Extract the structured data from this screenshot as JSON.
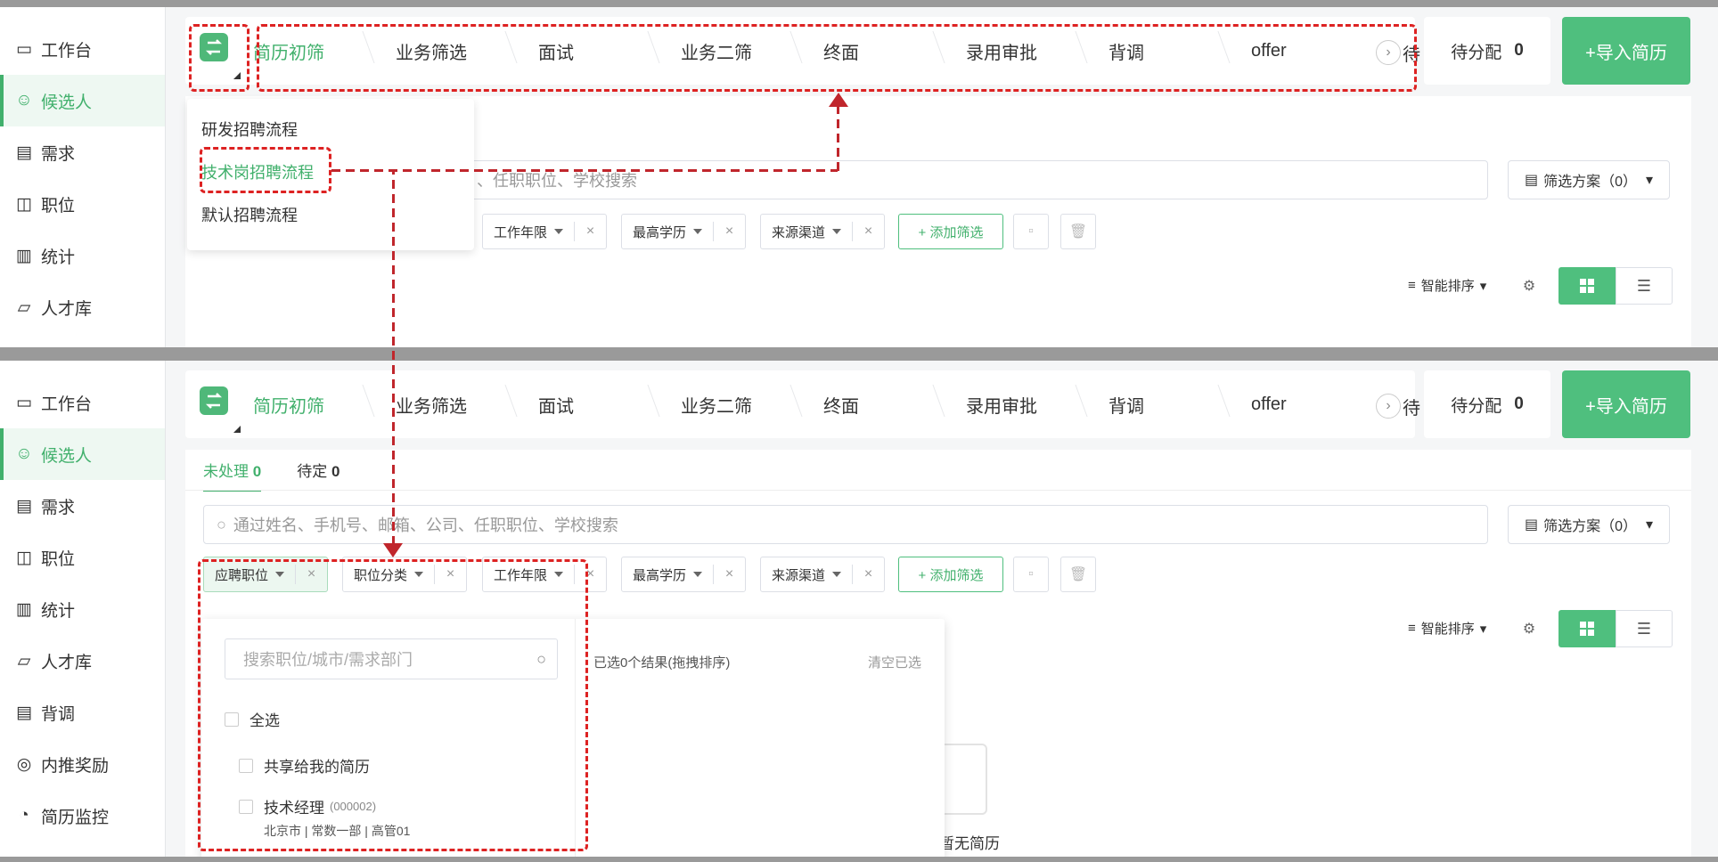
{
  "sidebar_top": [
    "工作台",
    "候选人",
    "需求",
    "职位",
    "统计",
    "人才库"
  ],
  "sidebar_bottom": [
    "工作台",
    "候选人",
    "需求",
    "职位",
    "统计",
    "人才库",
    "背调",
    "内推奖励",
    "简历监控"
  ],
  "stages": [
    "简历初筛",
    "业务筛选",
    "面试",
    "业务二筛",
    "终面",
    "录用审批",
    "背调",
    "offer"
  ],
  "stage_overflow": "待",
  "pending_label": "待分配",
  "pending_count": "0",
  "import_label": "+导入简历",
  "flow_menu": [
    "研发招聘流程",
    "技术岗招聘流程",
    "默认招聘流程"
  ],
  "tabs": [
    {
      "label": "未处理",
      "count": "0"
    },
    {
      "label": "待定",
      "count": "0"
    }
  ],
  "search_placeholder": "通过姓名、手机号、邮箱、公司、任职职位、学校搜索",
  "search_placeholder_top_partial": "、任职职位、学校搜索",
  "scheme_label": "筛选方案（0）",
  "filters": [
    "应聘职位",
    "职位分类",
    "工作年限",
    "最高学历",
    "来源渠道"
  ],
  "add_filter": "+ 添加筛选",
  "sort_label": "智能排序",
  "dropdown": {
    "search_placeholder": "搜索职位/城市/需求部门",
    "select_all": "全选",
    "shared": "共享给我的简历",
    "job_name": "技术经理",
    "job_code": "(000002)",
    "job_meta": [
      "北京市",
      "常数一部",
      "高管01"
    ],
    "selected_text": "已选0个结果(拖拽排序)",
    "clear": "清空已选",
    "empty": "暂无简历"
  },
  "colors": {
    "accent": "#41b06c",
    "annotation": "#d22222"
  }
}
